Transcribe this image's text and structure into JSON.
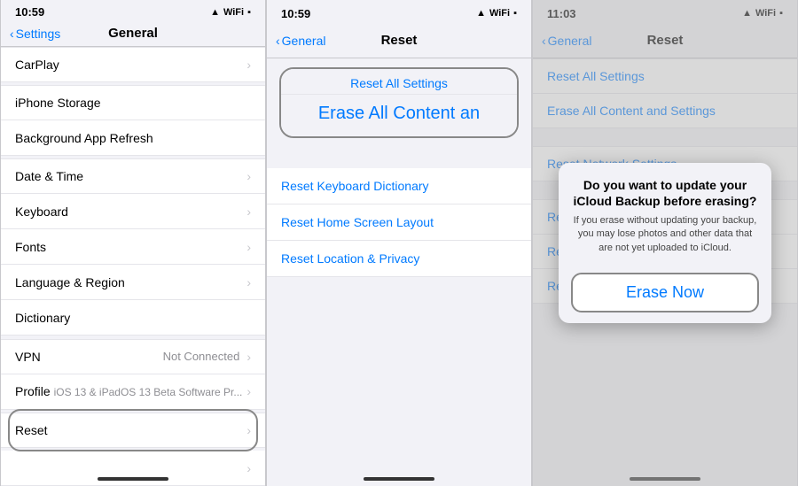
{
  "panel1": {
    "statusBar": {
      "time": "10:59",
      "signal": "▲",
      "wifi": "WiFi",
      "battery": "Battery"
    },
    "navBack": "Settings",
    "navTitle": "General",
    "items": [
      {
        "label": "CarPlay",
        "value": "",
        "chevron": true
      },
      {
        "label": "iPhone Storage",
        "value": "",
        "chevron": false
      },
      {
        "label": "Background App Refresh",
        "value": "",
        "chevron": false
      },
      {
        "label": "Date & Time",
        "value": "",
        "chevron": true
      },
      {
        "label": "Keyboard",
        "value": "",
        "chevron": true
      },
      {
        "label": "Fonts",
        "value": "",
        "chevron": true
      },
      {
        "label": "Language & Region",
        "value": "",
        "chevron": true
      },
      {
        "label": "Dictionary",
        "value": "",
        "chevron": false
      },
      {
        "label": "VPN",
        "value": "Not Connected",
        "chevron": true
      },
      {
        "label": "Profile  iOS 13 & iPadOS 13 Beta Software Pr...",
        "value": "",
        "chevron": true
      },
      {
        "label": "Reset",
        "value": "",
        "chevron": true
      }
    ],
    "resetLabel": "Reset"
  },
  "panel2": {
    "statusBar": {
      "time": "10:59"
    },
    "navBack": "General",
    "navTitle": "Reset",
    "eraseAllText": "Erase All Content an",
    "resetTitle": "Reset All Settings",
    "links": [
      "Reset Keyboard Dictionary",
      "Reset Home Screen Layout",
      "Reset Location & Privacy"
    ]
  },
  "panel3": {
    "statusBar": {
      "time": "11:03"
    },
    "navBack": "General",
    "navTitle": "Reset",
    "listItems": [
      "Reset All Settings",
      "Erase All Content and Settings",
      "Reset Network Settings",
      "Reset",
      "Reset",
      "Reset"
    ],
    "modal": {
      "title": "Do you want to update your iCloud Backup before erasing?",
      "body": "If you erase without updating your backup, you may lose photos and other data that are not yet uploaded to iCloud.",
      "eraseNow": "Erase Now"
    }
  }
}
